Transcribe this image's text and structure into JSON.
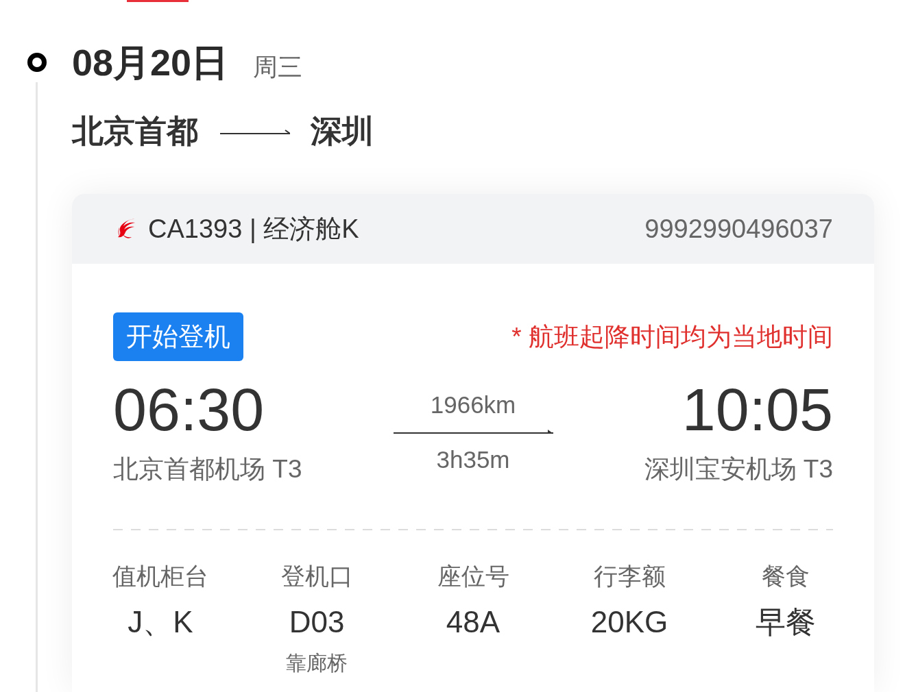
{
  "timeline": {
    "date": "08月20日",
    "weekday": "周三"
  },
  "route": {
    "from": "北京首都",
    "to": "深圳"
  },
  "flight_card": {
    "header": {
      "flight": "CA1393 | 经济舱K",
      "ticket_number": "9992990496037"
    },
    "status_badge": "开始登机",
    "note": "* 航班起降时间均为当地时间",
    "departure": {
      "time": "06:30",
      "airport": "北京首都机场 T3"
    },
    "distance": "1966km",
    "duration": "3h35m",
    "arrival": {
      "time": "10:05",
      "airport": "深圳宝安机场 T3"
    },
    "details": [
      {
        "label": "值机柜台",
        "value": "J、K"
      },
      {
        "label": "登机口",
        "value": "D03",
        "note": "靠廊桥"
      },
      {
        "label": "座位号",
        "value": "48A"
      },
      {
        "label": "行李额",
        "value": "20KG"
      },
      {
        "label": "餐食",
        "value": "早餐"
      }
    ]
  }
}
